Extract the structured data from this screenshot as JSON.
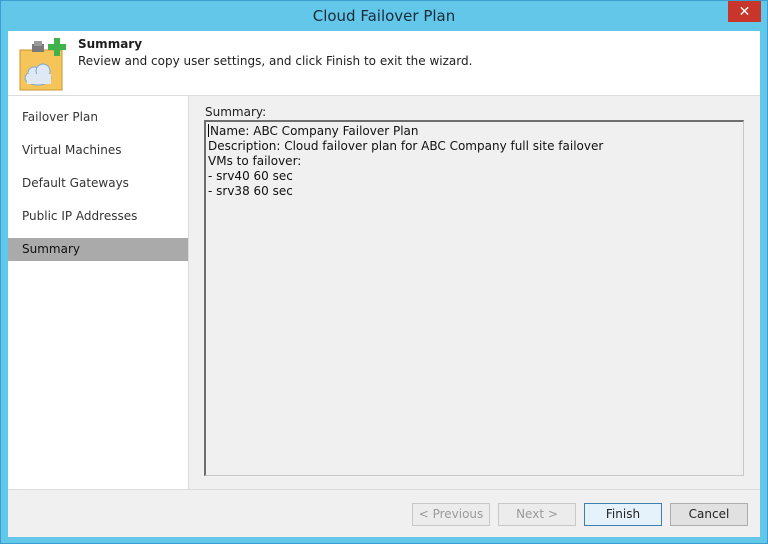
{
  "window": {
    "title": "Cloud Failover Plan",
    "close_glyph": "✕"
  },
  "header": {
    "title": "Summary",
    "description": "Review and copy user settings, and click Finish to exit the wizard.",
    "icon": "clipboard-cloud-add-icon"
  },
  "nav": {
    "items": [
      {
        "label": "Failover Plan",
        "active": false
      },
      {
        "label": "Virtual Machines",
        "active": false
      },
      {
        "label": "Default Gateways",
        "active": false
      },
      {
        "label": "Public IP Addresses",
        "active": false
      },
      {
        "label": "Summary",
        "active": true
      }
    ]
  },
  "summary": {
    "label": "Summary:",
    "lines": [
      "Name: ABC Company Failover Plan",
      "Description: Cloud failover plan for ABC Company full site failover",
      "VMs to failover:",
      "- srv40 60 sec",
      "- srv38 60 sec"
    ]
  },
  "buttons": {
    "previous": "< Previous",
    "next": "Next >",
    "finish": "Finish",
    "cancel": "Cancel"
  },
  "colors": {
    "titlebar": "#63c7ea",
    "close": "#c7352b",
    "nav_active": "#aaaaaa",
    "icon_folder": "#f6c55a",
    "icon_plus": "#3fb24a"
  }
}
